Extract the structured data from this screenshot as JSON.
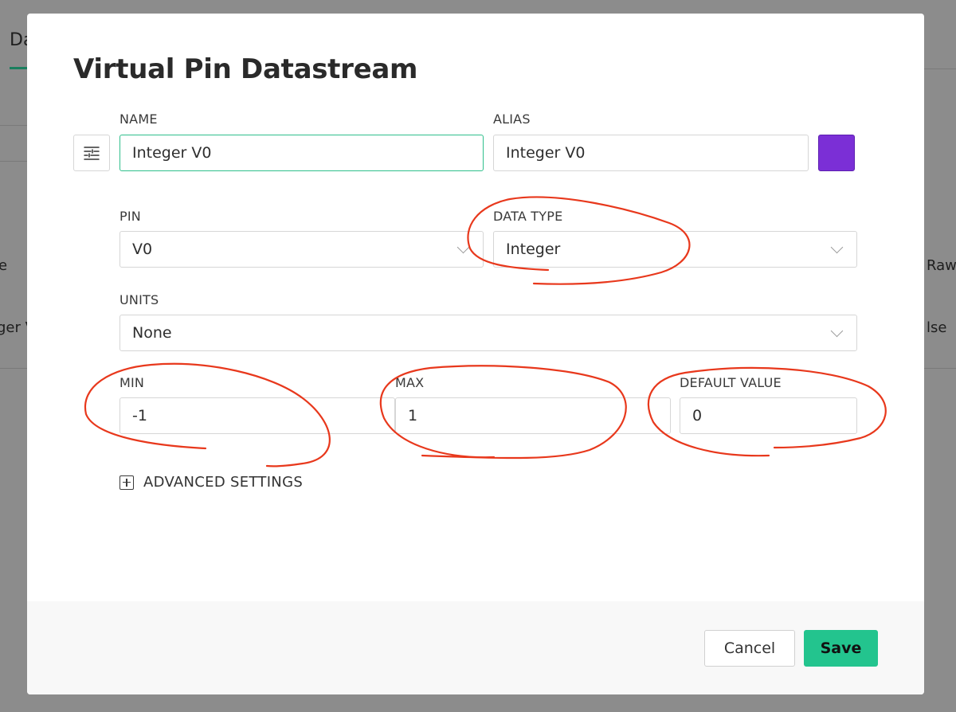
{
  "background": {
    "tab_label": "Da",
    "column_left": "e",
    "column_right": "Raw",
    "row_left": "ger V",
    "row_right": "lse"
  },
  "dialog": {
    "title": "Virtual Pin Datastream",
    "name": {
      "label": "NAME",
      "value": "Integer V0"
    },
    "alias": {
      "label": "ALIAS",
      "value": "Integer V0"
    },
    "color": "#7b2fd6",
    "settings_icon": "tune-icon",
    "pin": {
      "label": "PIN",
      "value": "V0"
    },
    "data_type": {
      "label": "DATA TYPE",
      "value": "Integer"
    },
    "units": {
      "label": "UNITS",
      "value": "None"
    },
    "min": {
      "label": "MIN",
      "value": "-1"
    },
    "max": {
      "label": "MAX",
      "value": "1"
    },
    "default_value": {
      "label": "DEFAULT VALUE",
      "value": "0"
    },
    "advanced_label": "ADVANCED SETTINGS",
    "cancel_label": "Cancel",
    "save_label": "Save"
  },
  "colors": {
    "accent": "#23c48e",
    "focus_border": "#2fbf8c",
    "annotation": "#e8381c"
  }
}
